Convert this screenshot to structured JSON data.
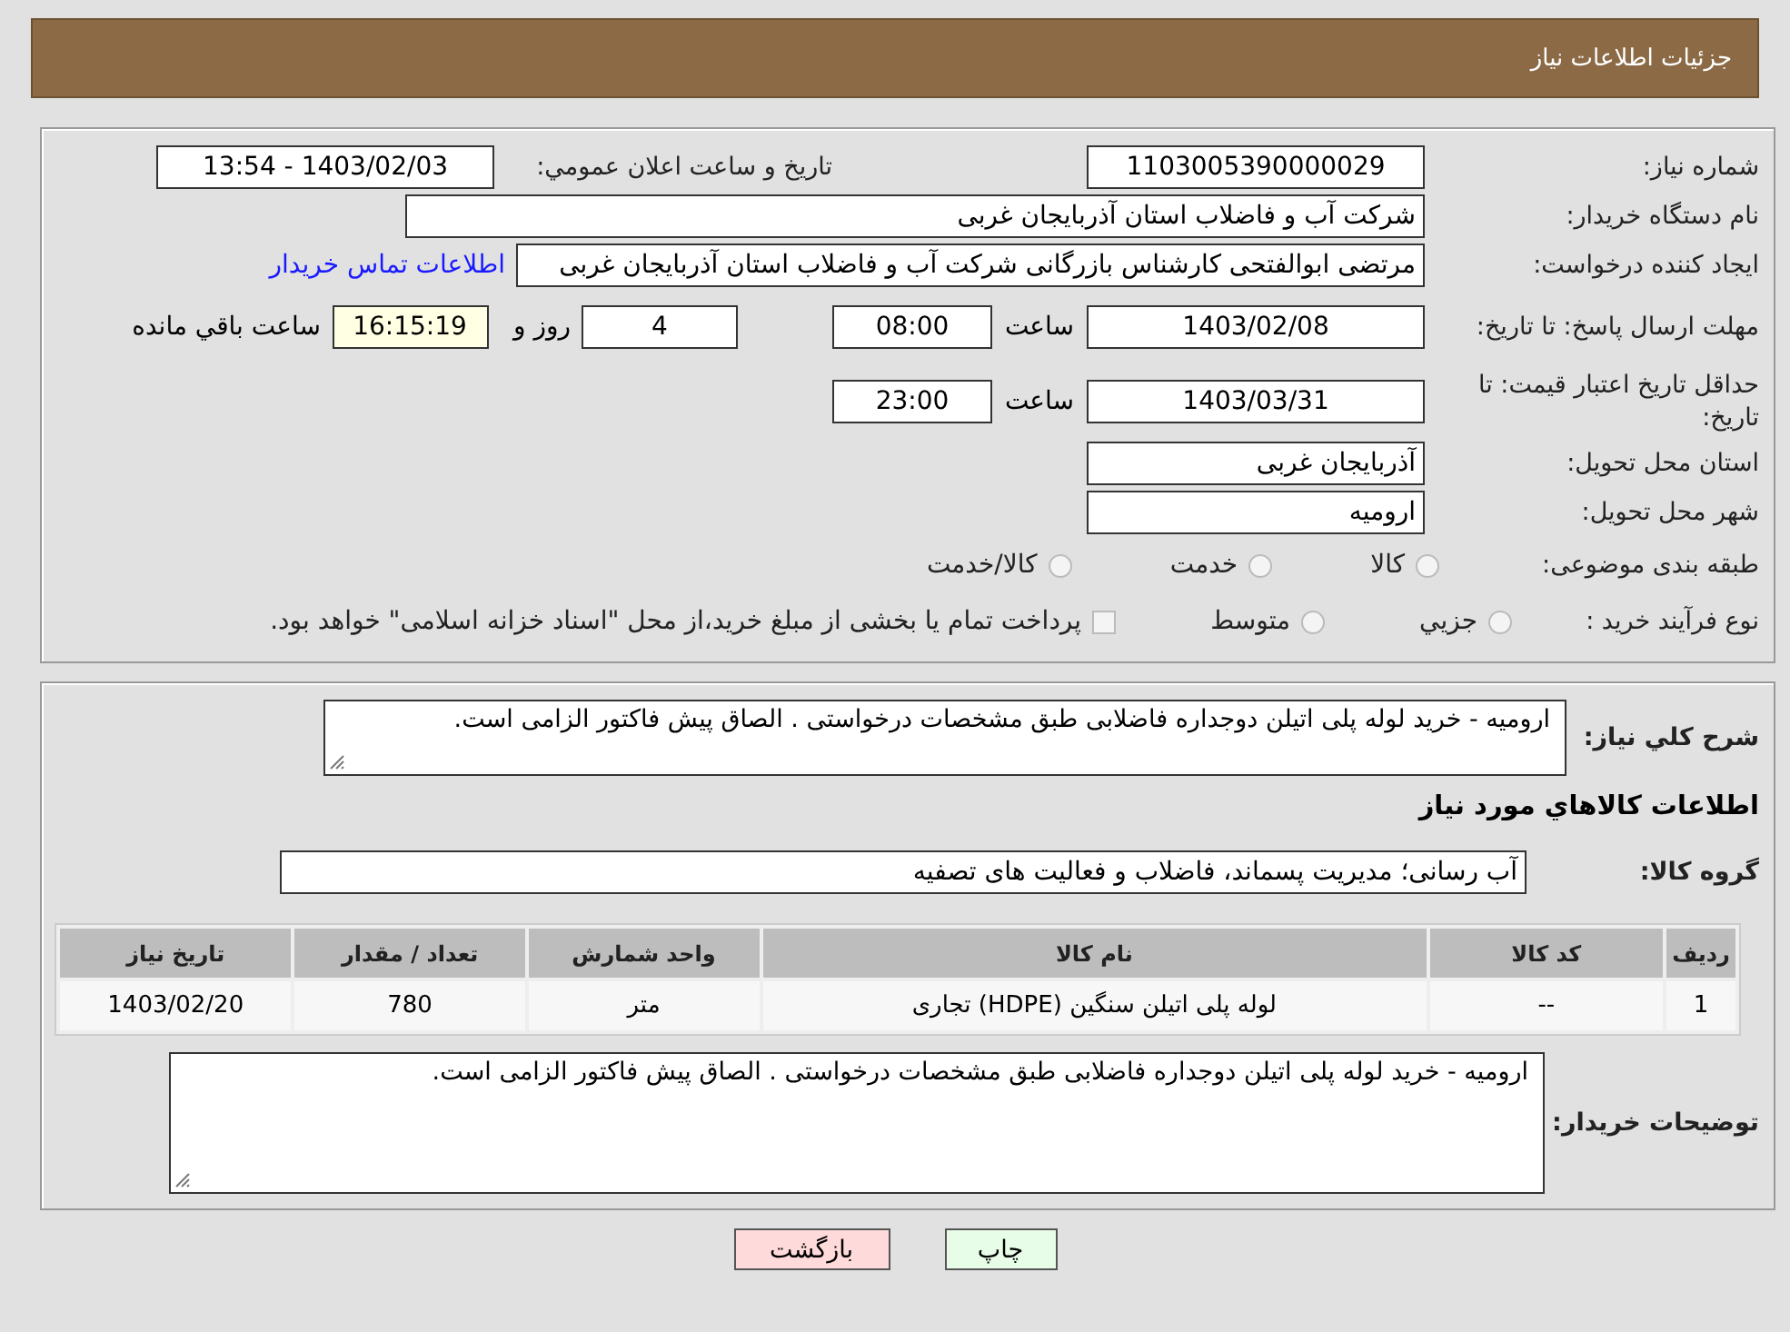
{
  "header": {
    "title": "جزئیات اطلاعات نیاز"
  },
  "need_number": {
    "label": "شماره نیاز:",
    "value": "1103005390000029"
  },
  "announce": {
    "label": "تاریخ و ساعت اعلان عمومي:",
    "value": "1403/02/03 - 13:54"
  },
  "buyer_org": {
    "label": "نام دستگاه خریدار:",
    "value": "شرکت آب و فاضلاب استان آذربایجان غربی"
  },
  "requester": {
    "label": "ایجاد کننده درخواست:",
    "value": "مرتضی ابوالفتحی کارشناس بازرگانی شرکت آب و فاضلاب استان آذربایجان غربی",
    "link": "اطلاعات تماس خریدار"
  },
  "reply_deadline": {
    "label": "مهلت ارسال پاسخ: تا تاریخ:",
    "date": "1403/02/08",
    "time_label": "ساعت",
    "time": "08:00",
    "days": "4",
    "days_label": "روز و",
    "remaining": "16:15:19",
    "remaining_label": "ساعت باقي مانده"
  },
  "price_validity": {
    "label": "حداقل تاریخ اعتبار قیمت: تا تاریخ:",
    "date": "1403/03/31",
    "time_label": "ساعت",
    "time": "23:00"
  },
  "delivery_province": {
    "label": "استان محل تحویل:",
    "value": "آذربایجان غربی"
  },
  "delivery_city": {
    "label": "شهر محل تحویل:",
    "value": "ارومیه"
  },
  "category": {
    "label": "طبقه بندی موضوعی:",
    "options": [
      {
        "label": "کالا",
        "selected": false
      },
      {
        "label": "خدمت",
        "selected": false
      },
      {
        "label": "کالا/خدمت",
        "selected": false
      }
    ]
  },
  "purchase_type": {
    "label": "نوع فرآیند خرید :",
    "options": [
      {
        "label": "جزيي",
        "selected": false
      },
      {
        "label": "متوسط",
        "selected": false
      }
    ],
    "treasury": {
      "label": "پرداخت تمام یا بخشی از مبلغ خرید،از محل \"اسناد خزانه اسلامی\" خواهد بود.",
      "checked": false
    }
  },
  "description": {
    "label": "شرح کلي نیاز:",
    "value": "ارومیه  -  خرید لوله پلی اتیلن دوجداره فاضلابی  طبق مشخصات درخواستی . الصاق پیش فاکتور الزامی است."
  },
  "goods_title": "اطلاعات کالاهاي مورد نیاز",
  "goods_group": {
    "label": "گروه کالا:",
    "value": "آب رسانی؛ مدیریت پسماند، فاضلاب و فعالیت های تصفیه"
  },
  "table": {
    "columns": [
      "ردیف",
      "کد کالا",
      "نام کالا",
      "واحد شمارش",
      "تعداد / مقدار",
      "تاریخ نیاز"
    ],
    "rows": [
      [
        "1",
        "--",
        "لوله پلی اتیلن سنگین (HDPE) تجاری",
        "متر",
        "780",
        "1403/02/20"
      ]
    ]
  },
  "buyer_notes": {
    "label": "توضیحات خریدار:",
    "value": "ارومیه  -  خرید لوله پلی اتیلن دوجداره فاضلابی  طبق مشخصات درخواستی . الصاق پیش فاکتور الزامی است."
  },
  "buttons": [
    {
      "label": "چاپ",
      "kind": "print"
    },
    {
      "label": "بازگشت",
      "kind": "back"
    }
  ]
}
